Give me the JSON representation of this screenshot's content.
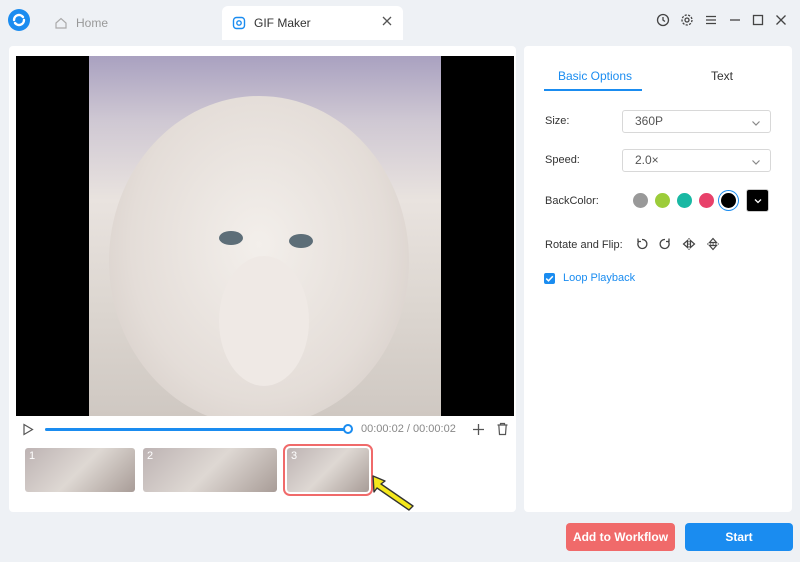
{
  "tabs": {
    "home_label": "Home",
    "gif_label": "GIF Maker"
  },
  "player": {
    "progress": 1.0,
    "current_time": "00:00:02",
    "separator": " / ",
    "total_time": "00:00:02"
  },
  "frames": [
    {
      "number": "1"
    },
    {
      "number": "2"
    },
    {
      "number": "3",
      "selected": true
    }
  ],
  "options": {
    "tab_basic": "Basic Options",
    "tab_text": "Text",
    "size_label": "Size:",
    "size_value": "360P",
    "speed_label": "Speed:",
    "speed_value": "2.0×",
    "backcolor_label": "BackColor:",
    "colors": [
      "#999999",
      "#9ccc3a",
      "#19b8a3",
      "#e8416a",
      "#000000"
    ],
    "selected_color": "#000000",
    "rotate_label": "Rotate and Flip:",
    "loop_label": "Loop Playback",
    "loop_checked": true
  },
  "footer": {
    "workflow_label": "Add to Workflow",
    "start_label": "Start"
  },
  "theme": {
    "accent": "#1a8cf0",
    "danger": "#f06a6a"
  }
}
